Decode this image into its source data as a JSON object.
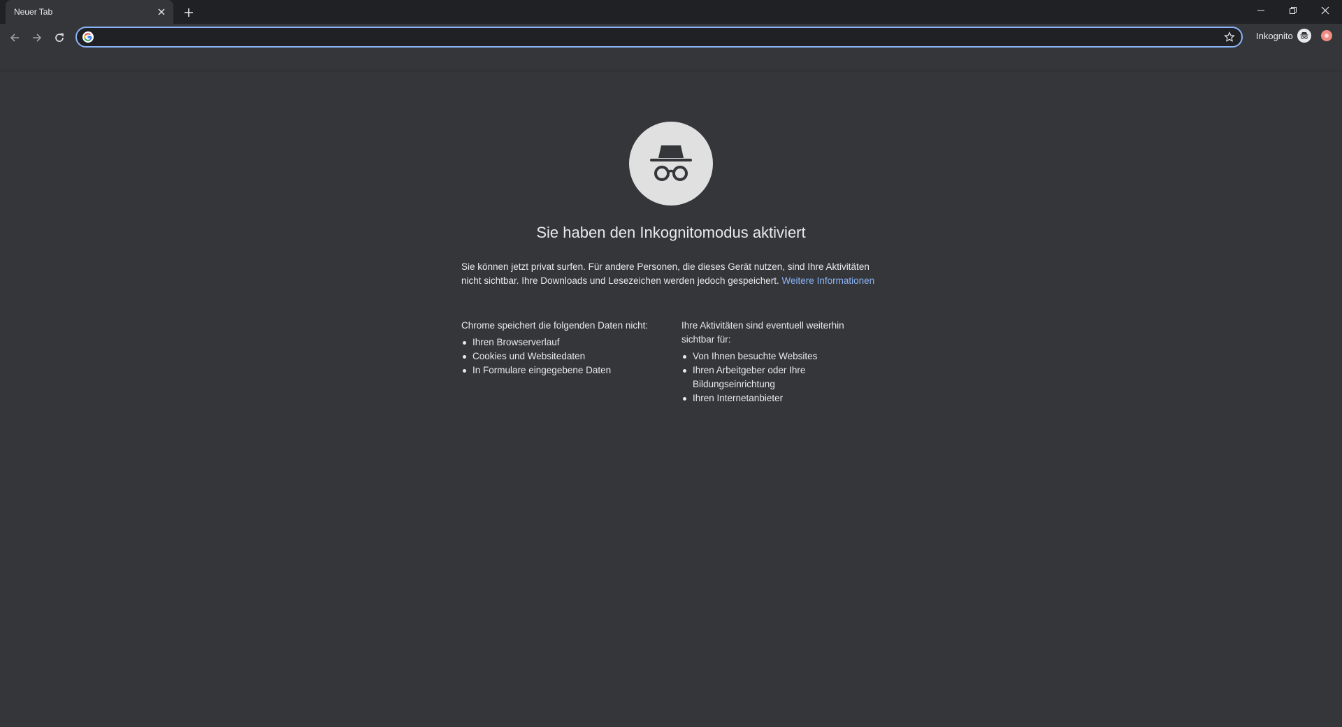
{
  "tab": {
    "title": "Neuer Tab"
  },
  "toolbar": {
    "omnibox_value": "",
    "profile_label": "Inkognito"
  },
  "content": {
    "heading": "Sie haben den Inkognitomodus aktiviert",
    "intro_text": "Sie können jetzt privat surfen. Für andere Personen, die dieses Gerät nutzen, sind Ihre Aktivitäten nicht sichtbar. Ihre Downloads und Lesezeichen werden jedoch gespeichert. ",
    "learn_more_link": "Weitere Informationen",
    "left_column": {
      "title": "Chrome speichert die folgenden Daten nicht:",
      "items": [
        "Ihren Browserverlauf",
        "Cookies und Websitedaten",
        "In Formulare eingegebene Daten"
      ]
    },
    "right_column": {
      "title": "Ihre Aktivitäten sind eventuell weiterhin sichtbar für:",
      "items": [
        "Von Ihnen besuchte Websites",
        "Ihren Arbeitgeber oder Ihre Bildungseinrichtung",
        "Ihren Internetanbieter"
      ]
    }
  },
  "icons": {
    "tab_close": "close-icon",
    "new_tab": "plus-icon",
    "minimize": "minimize-icon",
    "restore": "restore-icon",
    "close_window": "close-icon",
    "back": "arrow-left-icon",
    "forward": "arrow-right-icon",
    "reload": "reload-icon",
    "search_engine": "google-icon",
    "bookmark": "star-icon",
    "incognito": "incognito-icon",
    "extension": "extension-icon"
  },
  "colors": {
    "background": "#35363a",
    "tabstrip": "#202124",
    "link": "#8ab4f8",
    "focus_ring": "#8ab4f8"
  }
}
